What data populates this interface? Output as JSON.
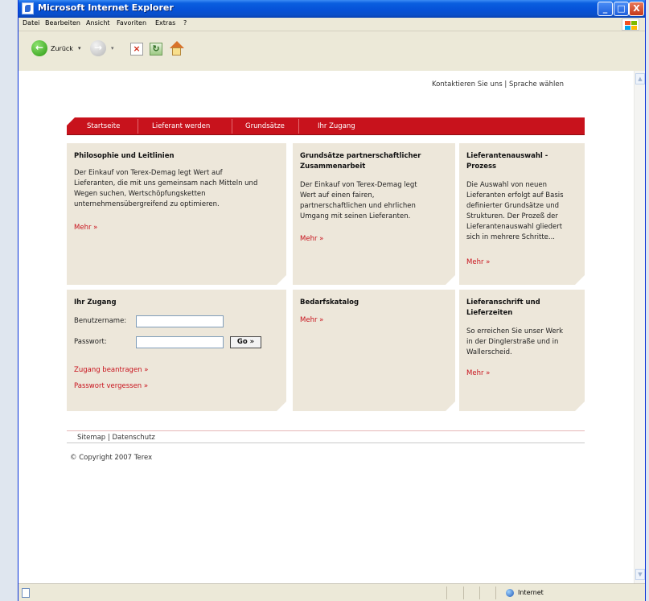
{
  "window": {
    "title": "Microsoft Internet Explorer",
    "controls": {
      "minimize": "_",
      "maximize": "□",
      "close": "X"
    }
  },
  "menubar": {
    "items": [
      "Datei",
      "Bearbeiten",
      "Ansicht",
      "Favoriten",
      "Extras",
      "?"
    ]
  },
  "toolbar": {
    "back_label": "Zurück",
    "back_dropdown": "▾",
    "forward_dropdown": "▾",
    "icons": [
      "back-icon",
      "forward-icon",
      "stop-icon",
      "refresh-icon",
      "home-icon"
    ]
  },
  "statusbar": {
    "zone": "Internet"
  },
  "page": {
    "toplinks": {
      "contact": "Kontaktieren Sie uns",
      "separator": "|",
      "language": "Sprache wählen"
    },
    "nav": [
      "Startseite",
      "Lieferant werden",
      "Grundsätze",
      "Ihr Zugang"
    ],
    "cards": {
      "philosophy": {
        "title": "Philosophie und Leitlinien",
        "body": [
          "Der Einkauf von Terex-Demag legt Wert auf",
          "Lieferanten, die mit uns gemeinsam nach Mitteln und",
          "Wegen suchen, Wertschöpfungsketten",
          "unternehmensübergreifend zu optimieren."
        ],
        "more": "Mehr »"
      },
      "principles": {
        "title": [
          "Grundsätze partnerschaftlicher",
          "Zusammenarbeit"
        ],
        "body": [
          "Der Einkauf von Terex-Demag legt",
          "Wert auf einen fairen,",
          "partnerschaftlichen und ehrlichen",
          "Umgang mit seinen Lieferanten."
        ],
        "more": "Mehr »"
      },
      "selection": {
        "title": [
          "Lieferantenauswahl -",
          "Prozess"
        ],
        "body": [
          "Die Auswahl von neuen",
          "Lieferanten erfolgt auf Basis",
          "definierter Grundsätze und",
          "Strukturen. Der Prozeß der",
          "Lieferantenauswahl gliedert",
          "sich in mehrere Schritte..."
        ],
        "more": "Mehr »"
      },
      "access": {
        "title": "Ihr Zugang",
        "username_label": "Benutzername:",
        "password_label": "Passwort:",
        "go": "Go »",
        "request_access": "Zugang beantragen »",
        "forgot_password": "Passwort vergessen »"
      },
      "catalog": {
        "title": "Bedarfskatalog",
        "more": "Mehr »"
      },
      "address": {
        "title": [
          "Lieferanschrift und",
          "Lieferzeiten"
        ],
        "body": [
          "So erreichen Sie unser Werk",
          "in der Dinglerstraße und in",
          "Wallerscheid."
        ],
        "more": "Mehr »"
      }
    },
    "footer": {
      "sitemap": "Sitemap",
      "separator": "|",
      "privacy": "Datenschutz",
      "copyright": "© Copyright 2007 Terex"
    }
  }
}
